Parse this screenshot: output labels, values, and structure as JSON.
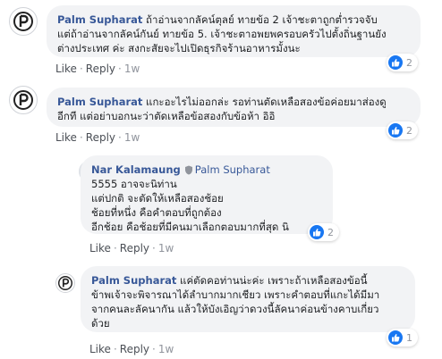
{
  "comments": [
    {
      "author": "Palm Supharat",
      "lines": [
        "ถ้าอ่านจากลัคน์ตุลย์ ทายข้อ 2 เจ้าชะตาถูกต่ำรวจจับ",
        "แต่ถ้าอ่านจากลัคน์กันย์ ทายข้อ 5. เจ้าชะตาอพยพครอบครัวไปตั้งถิ่นฐานยัง",
        "ต่างประเทศ ค่ะ สงกะสัยจะไปเปิดธุรกิจร้านอาหารมั้งนะ"
      ],
      "actions": {
        "like": "Like",
        "reply": "Reply",
        "time": "1w"
      },
      "reactions": "2"
    },
    {
      "author": "Palm Supharat",
      "lines": [
        "แกะอะไรไม่ออกล่ะ รอท่านตัดเหลือสองข้อค่อยมาส่องดู",
        "อีกที แต่อย่าบอกนะว่าตัดเหลือข้อสองกับข้อห้า อิอิ"
      ],
      "actions": {
        "like": "Like",
        "reply": "Reply",
        "time": "1w"
      },
      "reactions": "2"
    },
    {
      "author": "Nar Kalamaung",
      "tagged": "Palm Supharat",
      "lines": [
        "5555 อาจจะนิท่าน",
        "แต่ปกติ จะตัดให้เหลือสองช้อย",
        "ช้อยที่หนึ่ง คือคำตอบที่ถูกต้อง",
        "อีกช้อย คือช้อยที่มีคนมาเลือกตอบมากที่สุด นิ"
      ],
      "actions": {
        "like": "Like",
        "reply": "Reply",
        "time": "1w"
      },
      "reactions": "2"
    },
    {
      "author": "Palm Supharat",
      "lines": [
        "แค่ตัดคอท่านน่ะค่ะ เพราะถ้าเหลือสองข้อนี้",
        "ข้าพเจ้าจะพิจารณาได้ลำบากมากเชียว เพราะคำตอบที่แกะได้มีมา",
        "จากคนละลัคนากัน แล้วให้บังเอิญว่าดวงนี้ลัคนาค่อนข้างคาบเกี่ยว",
        "ด้วย"
      ],
      "actions": {
        "like": "Like",
        "reply": "Reply",
        "time": "1w"
      },
      "reactions": "1"
    }
  ]
}
